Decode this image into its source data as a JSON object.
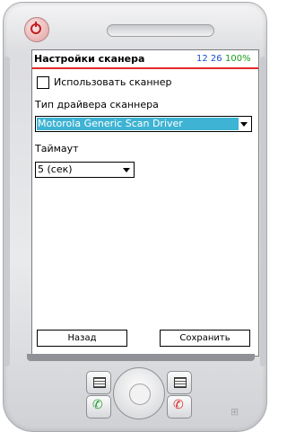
{
  "window": {
    "title": "Настройки сканера",
    "clock": "12 26",
    "battery": "100%"
  },
  "settings": {
    "use_scanner_label": "Использовать сканнер",
    "use_scanner_checked": false,
    "driver_label": "Тип драйвера сканнера",
    "driver_value": "Motorola Generic Scan Driver",
    "timeout_label": "Таймаут",
    "timeout_value": "5 (сек)"
  },
  "buttons": {
    "back": "Назад",
    "save": "Сохранить"
  },
  "colors": {
    "title_underline": "#e32a2a",
    "clock": "#1a4fd0",
    "battery": "#1a9b1a",
    "selection": "#3fb3d3"
  },
  "icons": {
    "power": "power-icon",
    "call": "call-icon",
    "end_call": "end-call-icon",
    "windows_logo": "windows-logo-icon"
  }
}
